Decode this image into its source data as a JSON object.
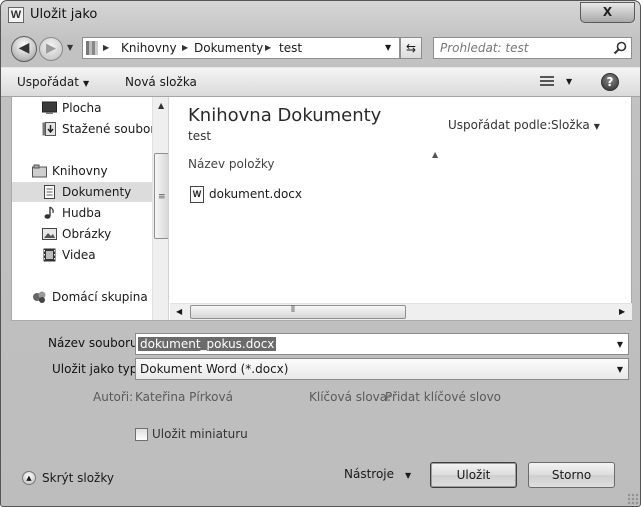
{
  "window": {
    "title": "Uložit jako",
    "app_icon_letter": "W",
    "close_label": "X"
  },
  "nav": {
    "back_glyph": "◀",
    "forward_glyph": "▶",
    "breadcrumb": [
      "Knihovny",
      "Dokumenty",
      "test"
    ],
    "search_placeholder": "Prohledat: test",
    "refresh_glyph": "⇆"
  },
  "toolbar": {
    "organize_label": "Uspořádat",
    "new_folder_label": "Nová složka",
    "help_label": "?"
  },
  "sidebar": {
    "items": [
      {
        "label": "Plocha",
        "icon": "desktop-icon",
        "selected": false
      },
      {
        "label": "Stažené soubory",
        "icon": "downloads-icon",
        "selected": false
      },
      {
        "label": "Knihovny",
        "icon": "libraries-icon",
        "selected": false
      },
      {
        "label": "Dokumenty",
        "icon": "documents-icon",
        "selected": true
      },
      {
        "label": "Hudba",
        "icon": "music-icon",
        "selected": false
      },
      {
        "label": "Obrázky",
        "icon": "pictures-icon",
        "selected": false
      },
      {
        "label": "Videa",
        "icon": "videos-icon",
        "selected": false
      },
      {
        "label": "Domácí skupina",
        "icon": "homegroup-icon",
        "selected": false
      }
    ]
  },
  "main": {
    "library_title": "Knihovna Dokumenty",
    "library_subtitle": "test",
    "arrange_by_label": "Uspořádat podle:",
    "arrange_by_value": "Složka",
    "column_header": "Název položky",
    "files": [
      {
        "name": "dokument.docx",
        "icon": "word-document-icon",
        "icon_letter": "W"
      }
    ]
  },
  "form": {
    "filename_label": "Název souboru:",
    "filename_value": "dokument_pokus.docx",
    "filetype_label": "Uložit jako typ:",
    "filetype_value": "Dokument Word (*.docx)",
    "authors_label": "Autoři:",
    "authors_value": "Kateřina Pírková",
    "tags_label": "Klíčová slova:",
    "tags_value": "Přidat klíčové slovo",
    "thumbnail_label": "Uložit miniaturu",
    "thumbnail_checked": false
  },
  "footer": {
    "hide_folders_label": "Skrýt složky",
    "tools_label": "Nástroje",
    "save_label": "Uložit",
    "cancel_label": "Storno"
  }
}
